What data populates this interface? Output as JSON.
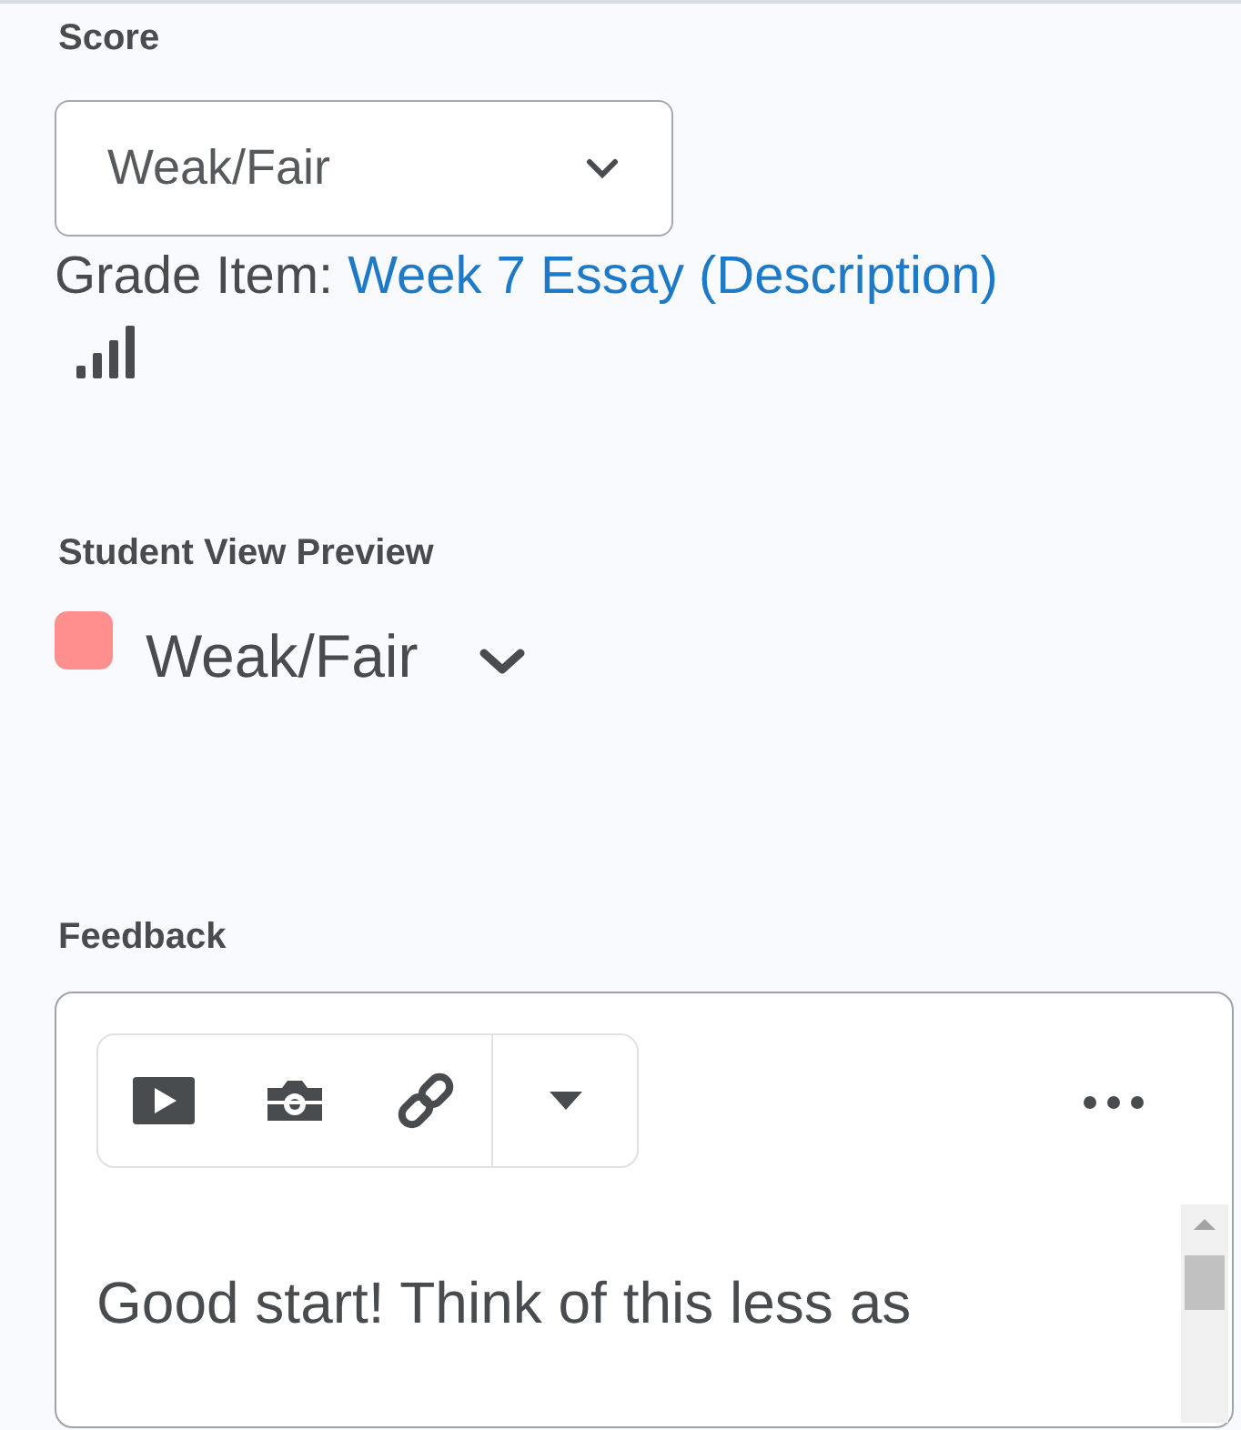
{
  "score": {
    "label": "Score",
    "value": "Weak/Fair"
  },
  "grade_item": {
    "label": "Grade Item:",
    "link": "Week 7 Essay (Description)"
  },
  "student_view_preview": {
    "label": "Student View Preview",
    "level_name": "Weak/Fair",
    "color": "#ff8f8f"
  },
  "feedback": {
    "label": "Feedback",
    "text": "Good start! Think of this less as"
  }
}
